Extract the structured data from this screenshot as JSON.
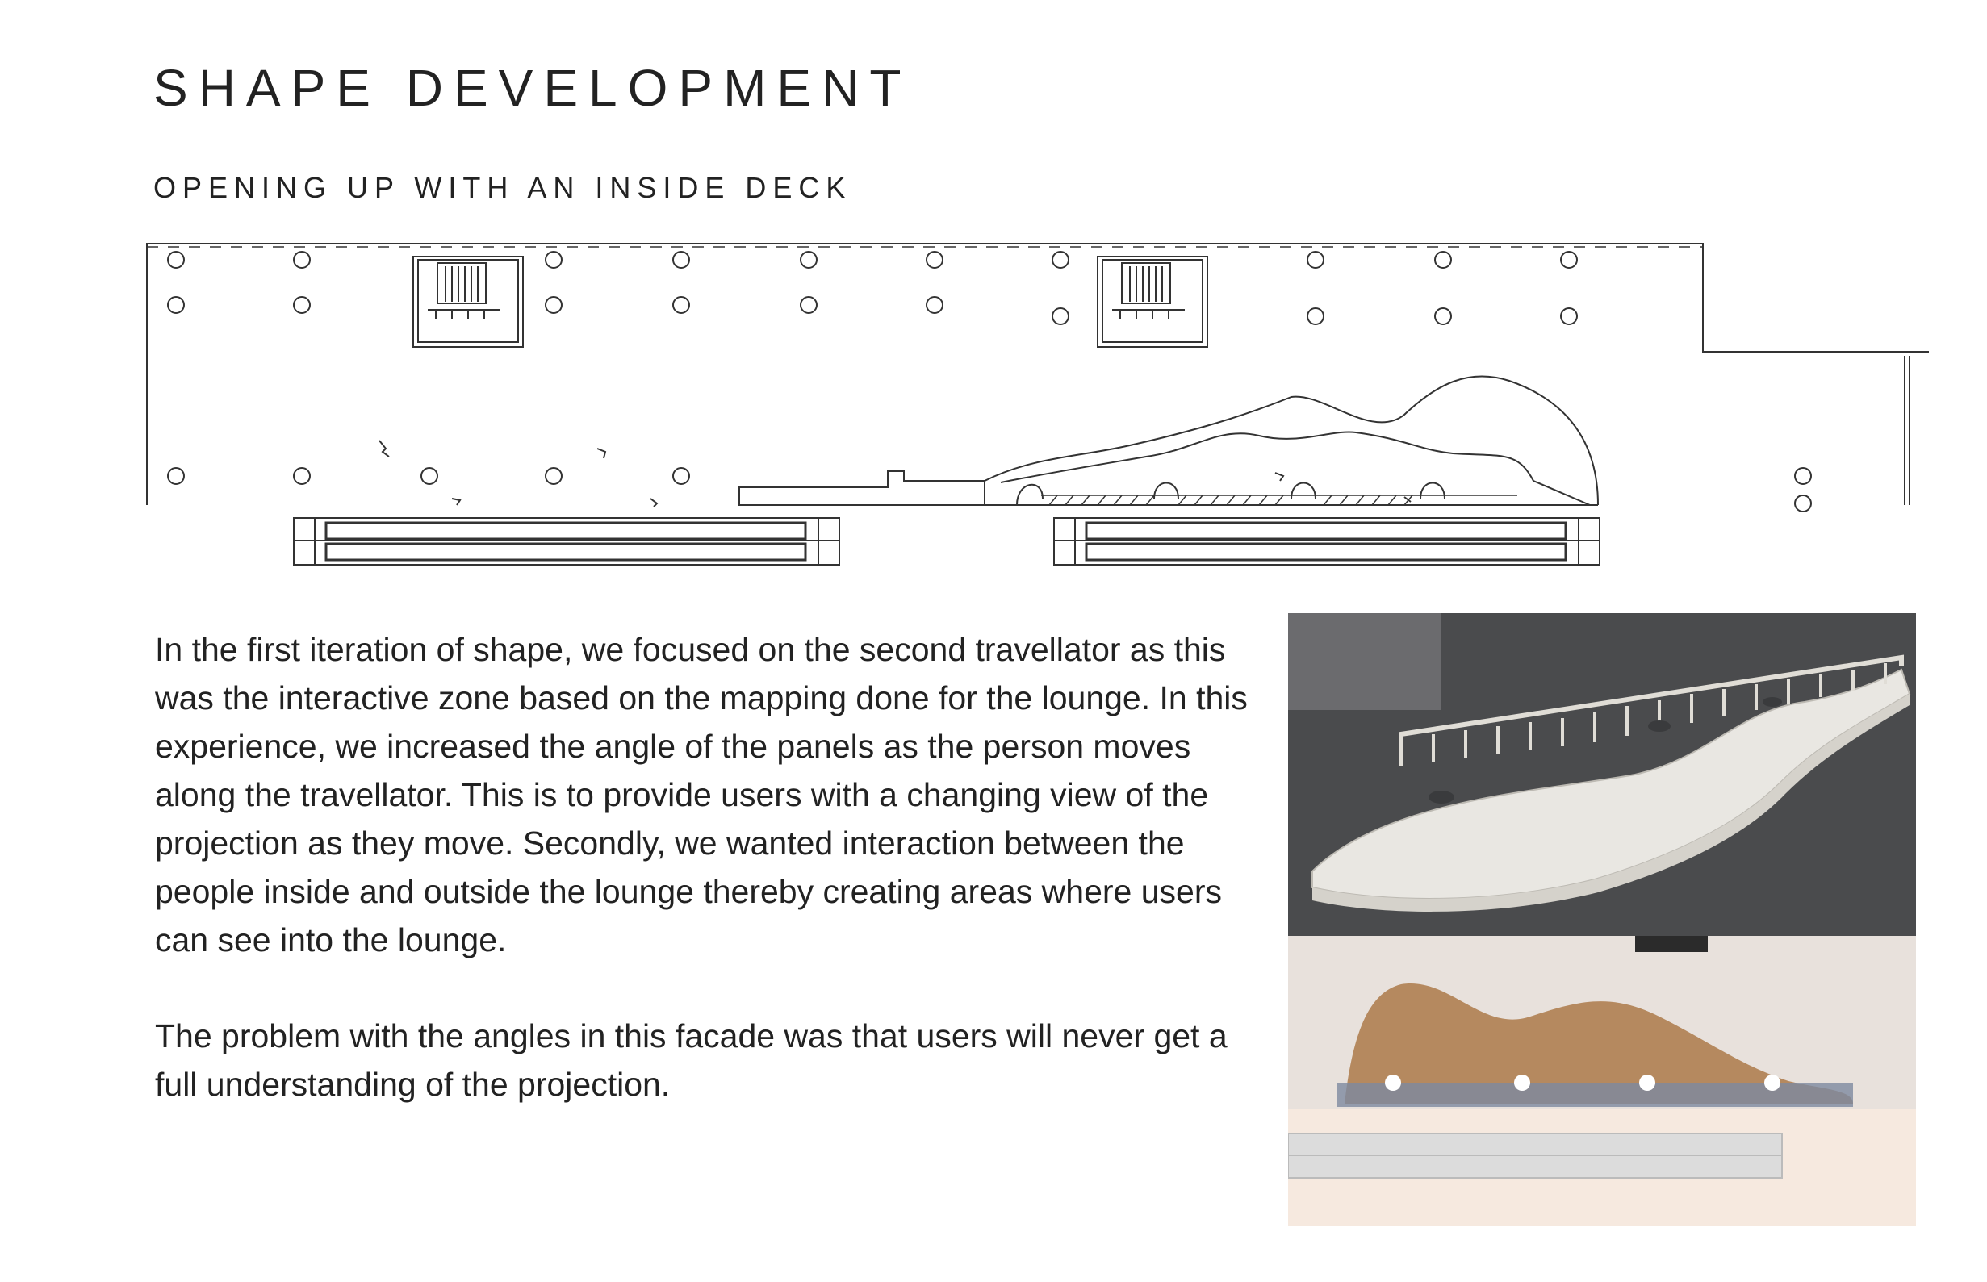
{
  "page": {
    "title": "SHAPE DEVELOPMENT",
    "subtitle": "OPENING UP WITH AN INSIDE DECK"
  },
  "text": {
    "paragraph_1": "In the first iteration of shape, we focused on the second travellator as this was the interactive zone based on the mapping done for the lounge. In this experience, we increased the angle of the panels as the person moves along the travellator. This is to provide users with a changing view of the projection as they move. Secondly, we wanted interaction between the people inside and outside the lounge thereby creating areas where users can see into the lounge.",
    "paragraph_2": "The problem with the angles in this facade was that users will never get a full understanding of the projection."
  },
  "colors": {
    "line": "#333333",
    "model_backdrop": "#4a4b4d",
    "model_surface": "#e9e7e2",
    "render_floor": "#f6e9df",
    "render_wood": "#b5895f"
  }
}
